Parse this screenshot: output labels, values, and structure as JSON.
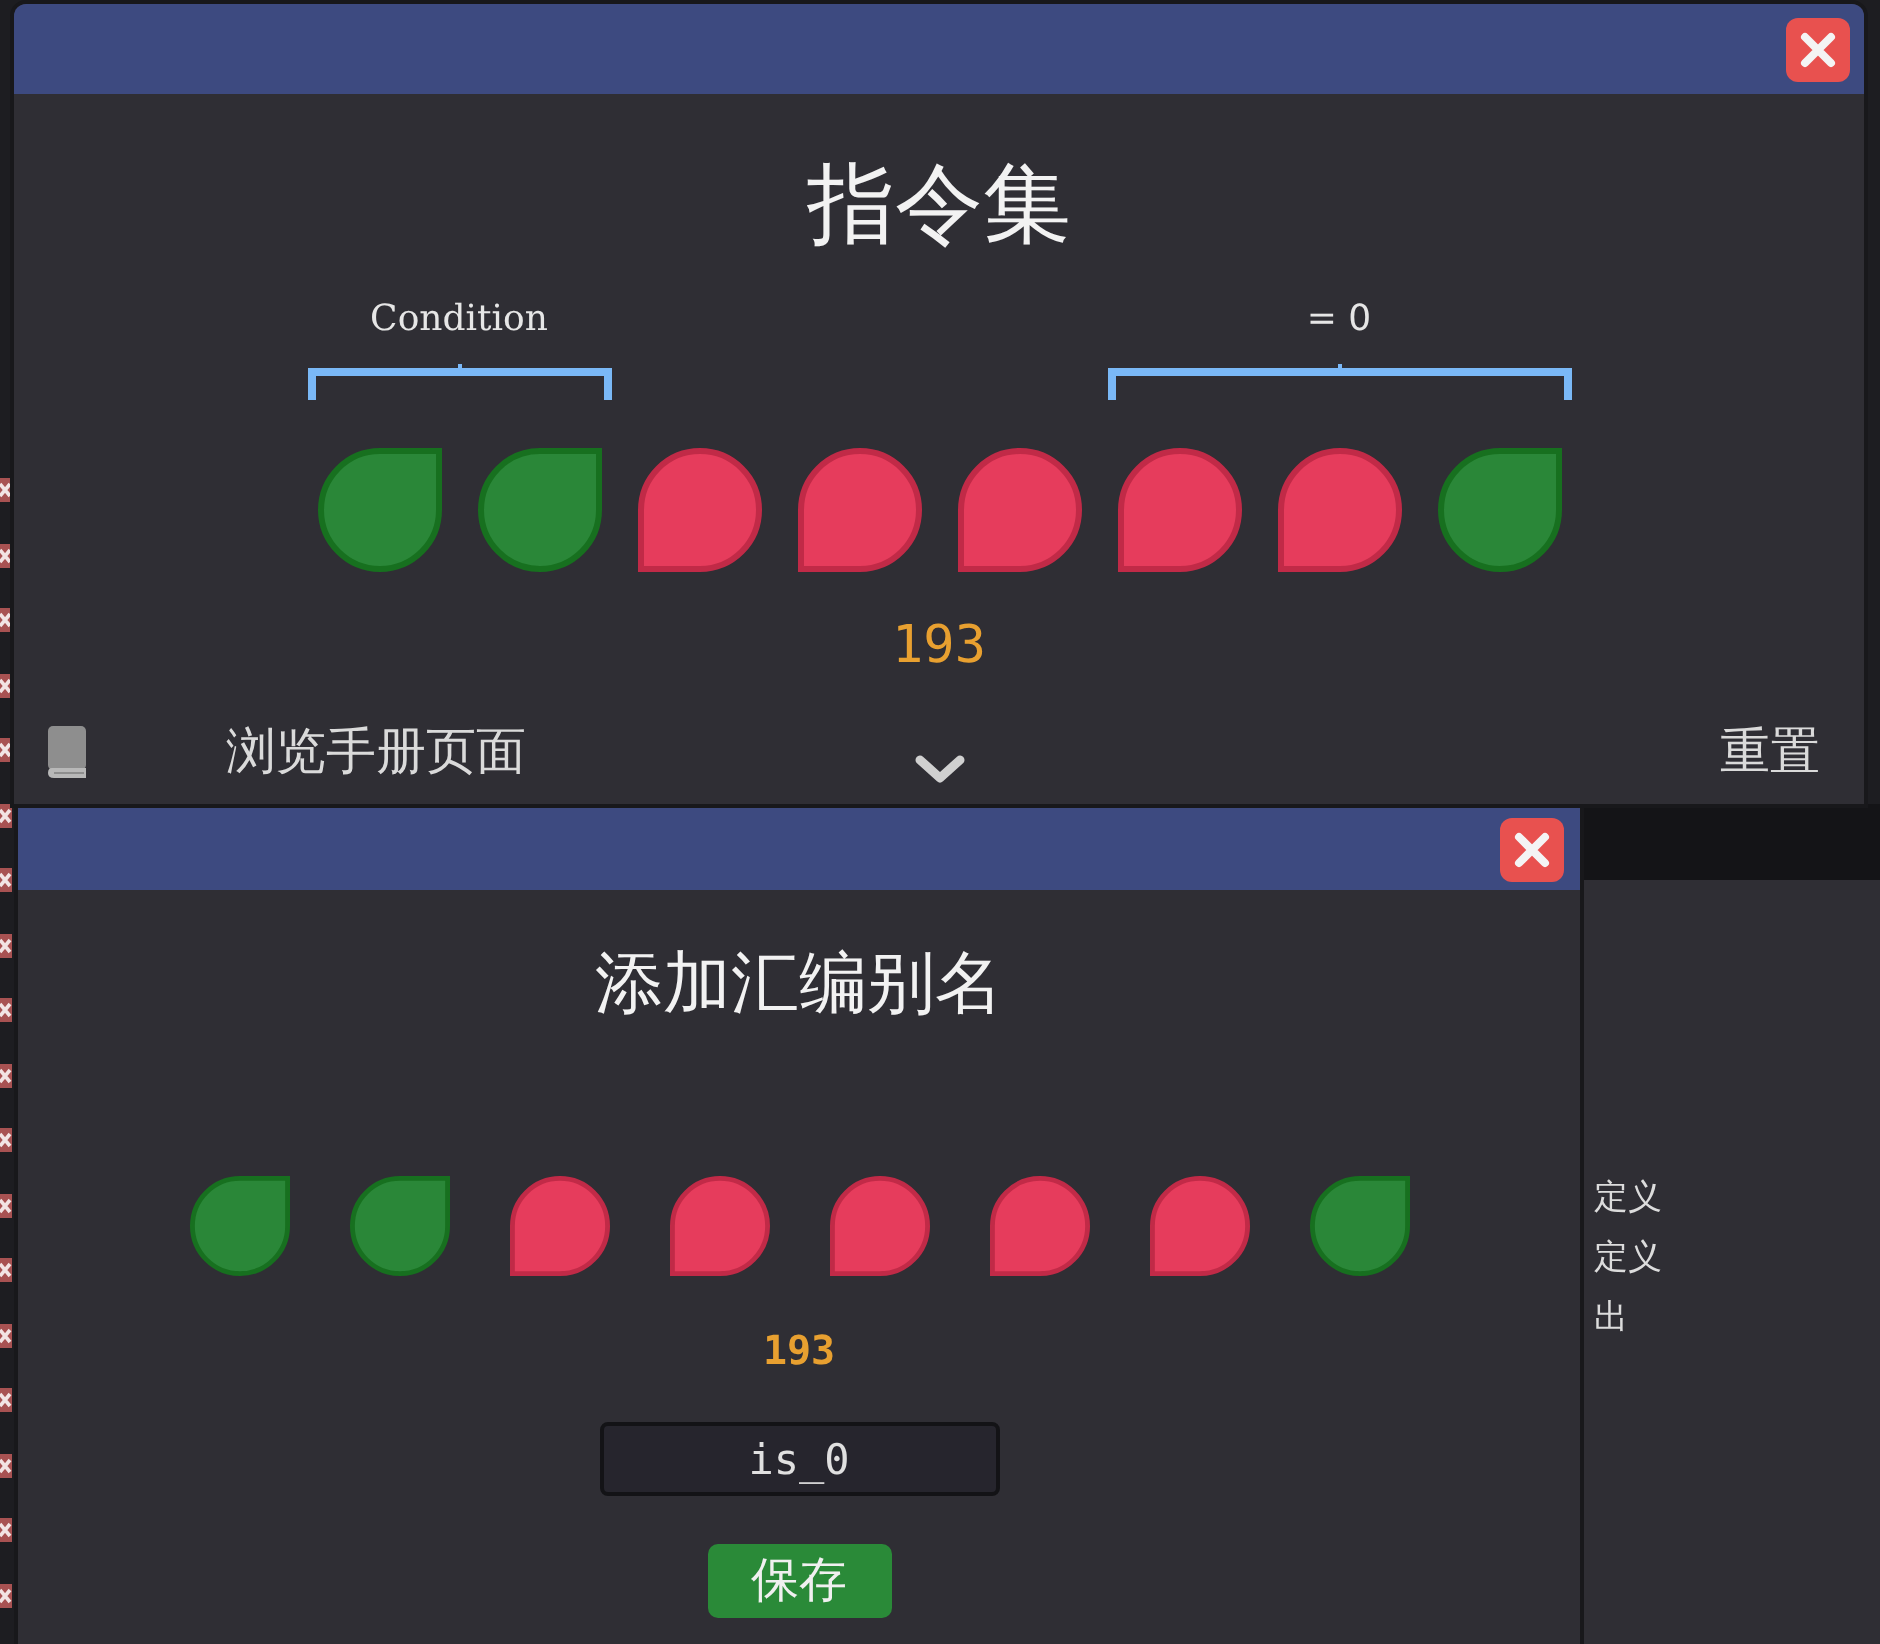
{
  "instruction_dialog": {
    "title": "指令集",
    "segments": [
      {
        "label": "Condition",
        "kind": "name",
        "bits": [
          {
            "on": true
          },
          {
            "on": true
          }
        ]
      },
      {
        "bits": [
          {
            "on": false
          },
          {
            "on": false
          },
          {
            "on": false
          }
        ]
      },
      {
        "label": "= 0",
        "kind": "expression",
        "bits": [
          {
            "on": false
          },
          {
            "on": false
          },
          {
            "on": true
          }
        ]
      }
    ],
    "value": "193",
    "manual_link": "浏览手册页面",
    "reset_button": "重置"
  },
  "alias_dialog": {
    "title": "添加汇编别名",
    "bits": [
      {
        "on": true
      },
      {
        "on": true
      },
      {
        "on": false
      },
      {
        "on": false
      },
      {
        "on": false
      },
      {
        "on": false
      },
      {
        "on": false
      },
      {
        "on": true
      }
    ],
    "value": "193",
    "name_field": {
      "value": "is_0"
    },
    "save_button": "保存"
  },
  "side_panel": {
    "items": [
      "定义",
      "定义",
      "出"
    ]
  }
}
